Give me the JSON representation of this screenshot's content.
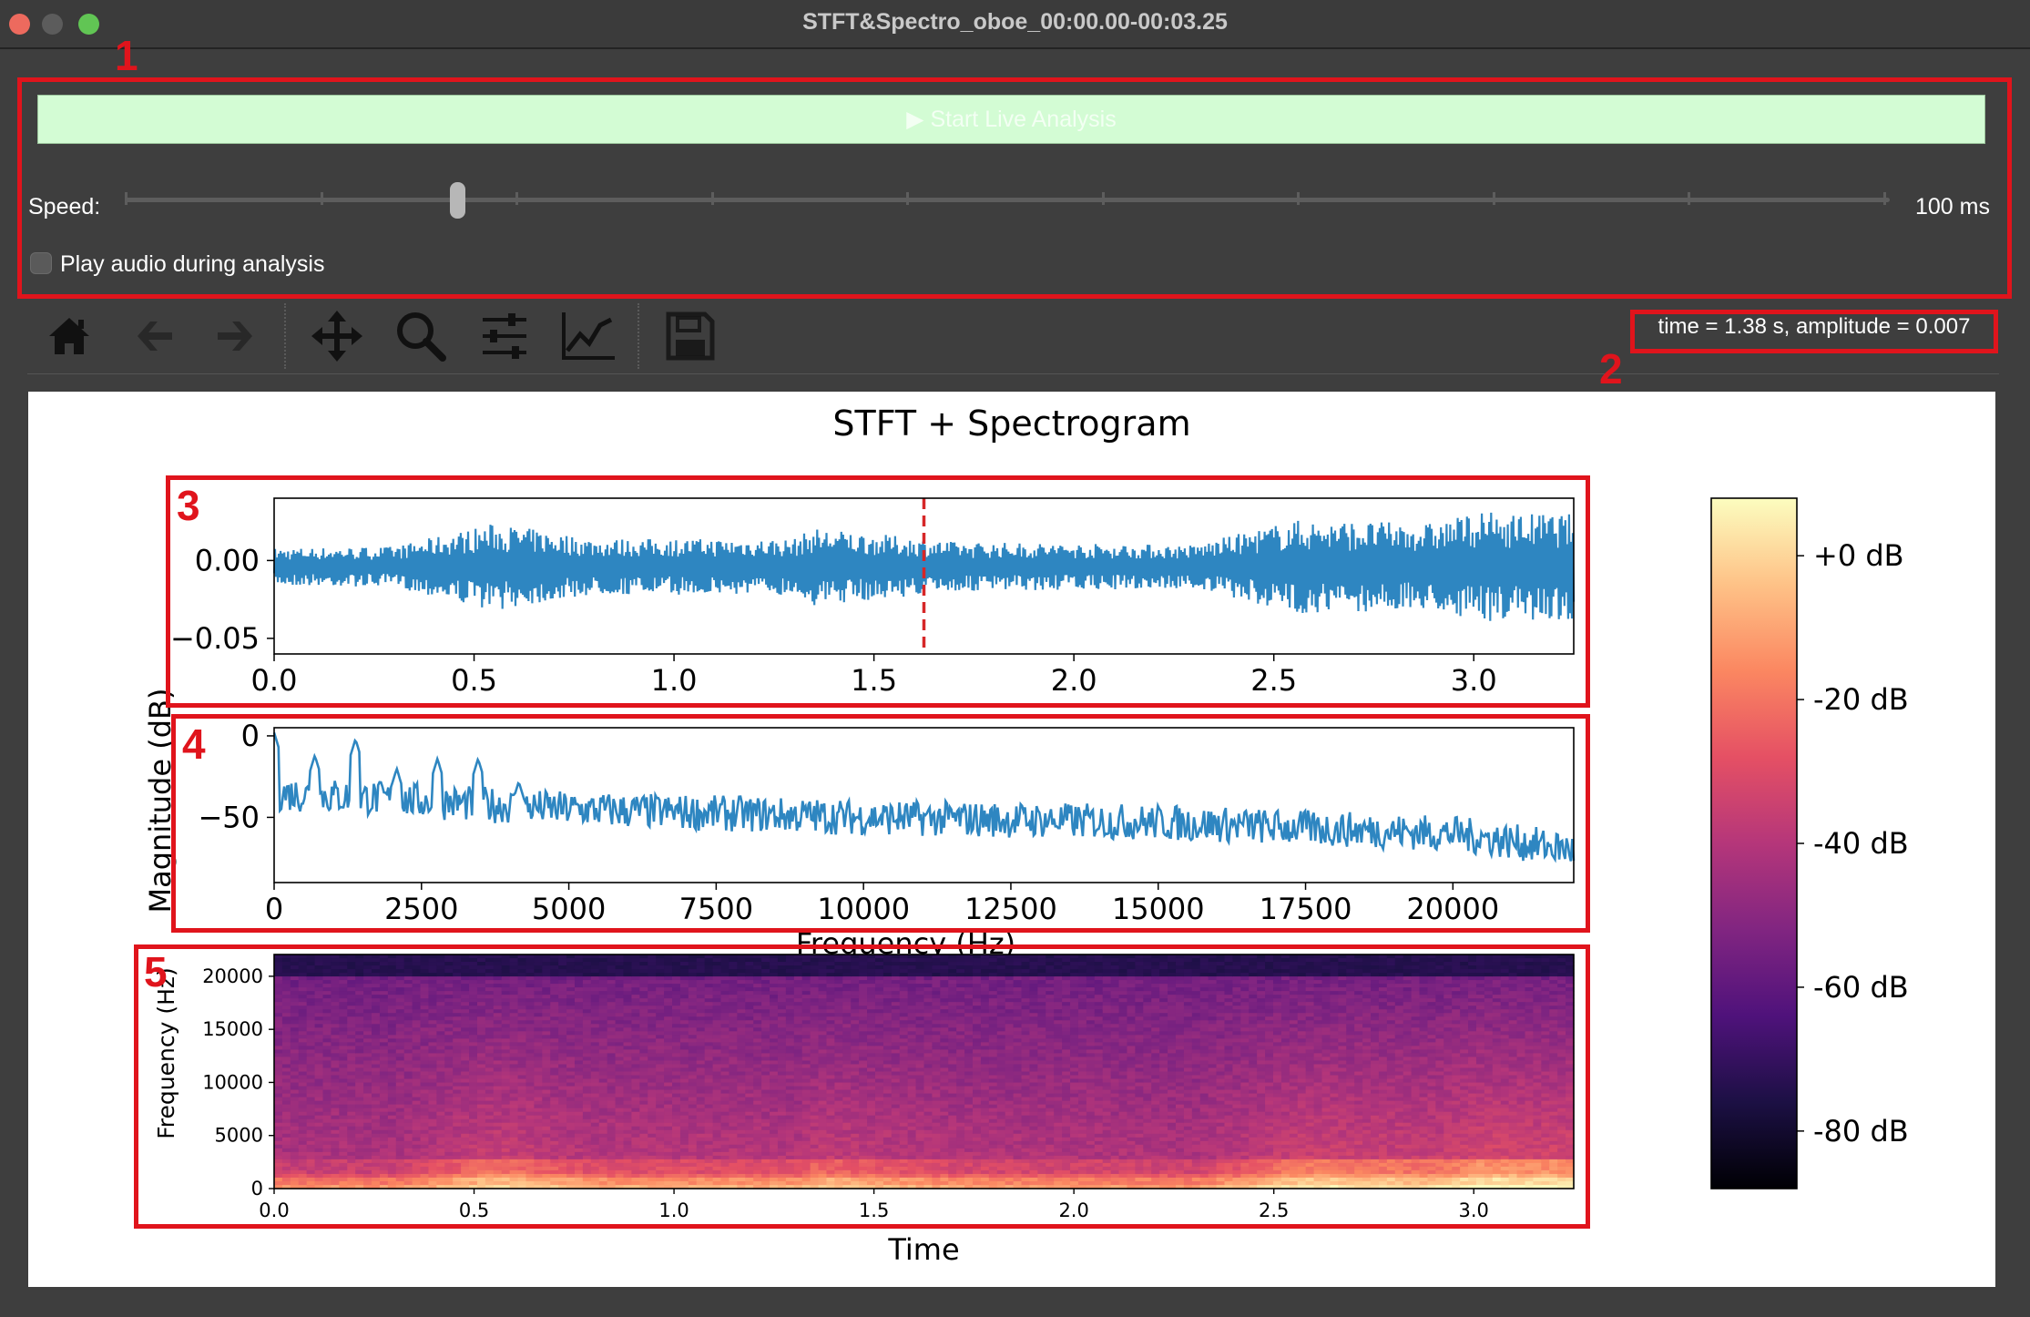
{
  "window": {
    "title": "STFT&Spectro_oboe_00:00.00-00:03.25",
    "traffic_lights": {
      "close": "#ed6a5e",
      "minimize": "#5c5c5c",
      "maximize": "#61c554"
    }
  },
  "controls": {
    "start_button_label": "▶ Start Live Analysis",
    "speed_label": "Speed:",
    "speed_value": "100 ms",
    "speed_slider_position": 0.17,
    "checkbox_label": "Play audio during analysis",
    "checkbox_checked": false
  },
  "toolbar": {
    "icons": [
      "home-icon",
      "back-arrow-icon",
      "forward-arrow-icon",
      "pan-icon",
      "zoom-icon",
      "configure-subplots-icon",
      "edit-axis-icon",
      "save-icon"
    ],
    "status_text": "time = 1.38 s, amplitude = 0.007"
  },
  "annotations": [
    "1",
    "2",
    "3",
    "4",
    "5"
  ],
  "annotation_color": "#e0141c",
  "chart_data": [
    {
      "type": "line",
      "panel": "waveform",
      "suptitle": "STFT + Spectrogram",
      "xlim": [
        0.0,
        3.25
      ],
      "ylim": [
        -0.06,
        0.04
      ],
      "xticks": [
        "0.0",
        "0.5",
        "1.0",
        "1.5",
        "2.0",
        "2.5",
        "3.0"
      ],
      "yticks": [
        "0.00",
        "−0.05"
      ],
      "cursor_x": 1.625,
      "line_color": "#2e86c1",
      "envelope": {
        "x": [
          0.0,
          0.3,
          0.55,
          0.8,
          1.3,
          1.35,
          1.7,
          2.3,
          2.55,
          2.9,
          3.0,
          3.25
        ],
        "amp": [
          0.012,
          0.013,
          0.028,
          0.018,
          0.018,
          0.025,
          0.016,
          0.014,
          0.03,
          0.028,
          0.035,
          0.034
        ]
      }
    },
    {
      "type": "line",
      "panel": "magnitude spectrum",
      "ylabel": "Magnitude (dB)",
      "xlabel": "Frequency (Hz)",
      "xlim": [
        0,
        22050
      ],
      "ylim": [
        -90,
        5
      ],
      "xticks": [
        "0",
        "2500",
        "5000",
        "7500",
        "10000",
        "12500",
        "15000",
        "17500",
        "20000"
      ],
      "yticks": [
        "0",
        "−50"
      ],
      "peaks": [
        {
          "x": 0,
          "y": 2
        },
        {
          "x": 690,
          "y": -12
        },
        {
          "x": 1380,
          "y": -2
        },
        {
          "x": 2080,
          "y": -20
        },
        {
          "x": 2770,
          "y": -14
        },
        {
          "x": 3460,
          "y": -14
        },
        {
          "x": 4150,
          "y": -28
        }
      ],
      "trend": {
        "x": [
          0,
          5000,
          10000,
          15000,
          20000,
          22050
        ],
        "y": [
          -35,
          -45,
          -50,
          -53,
          -60,
          -70
        ]
      },
      "line_color": "#2e86c1"
    },
    {
      "type": "heatmap",
      "panel": "spectrogram",
      "xlabel": "Time",
      "ylabel": "Frequency (Hz)",
      "xlim": [
        0.0,
        3.25
      ],
      "ylim": [
        0,
        22050
      ],
      "xticks": [
        "0.0",
        "0.5",
        "1.0",
        "1.5",
        "2.0",
        "2.5",
        "3.0"
      ],
      "yticks": [
        "0",
        "5000",
        "10000",
        "15000",
        "20000"
      ],
      "colormap": "magma",
      "colorbar": {
        "ticks": [
          "+0 dB",
          "-20 dB",
          "-40 dB",
          "-60 dB",
          "-80 dB"
        ],
        "range_db": [
          -88,
          8
        ]
      }
    }
  ]
}
